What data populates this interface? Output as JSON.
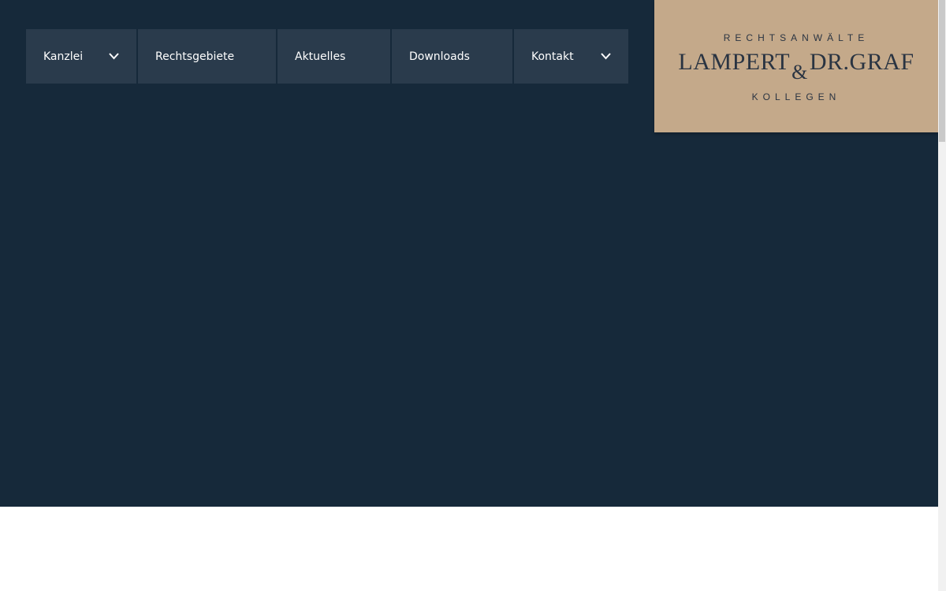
{
  "nav": {
    "items": [
      {
        "label": "Kanzlei",
        "has_dropdown": true
      },
      {
        "label": "Rechtsgebiete",
        "has_dropdown": false
      },
      {
        "label": "Aktuelles",
        "has_dropdown": false
      },
      {
        "label": "Downloads",
        "has_dropdown": false
      },
      {
        "label": "Kontakt",
        "has_dropdown": true
      }
    ]
  },
  "logo": {
    "top": "RECHTSANWÄLTE",
    "name_left": "LAMPERT",
    "ampersand": "&",
    "name_right": "DR.GRAF",
    "bottom": "KOLLEGEN"
  },
  "colors": {
    "hero_bg": "#16293a",
    "nav_bg": "#2a3b4c",
    "logo_bg": "#c4a98a",
    "logo_text": "#2a3442"
  },
  "icons": {
    "dropdown": "chevron-down-icon"
  }
}
